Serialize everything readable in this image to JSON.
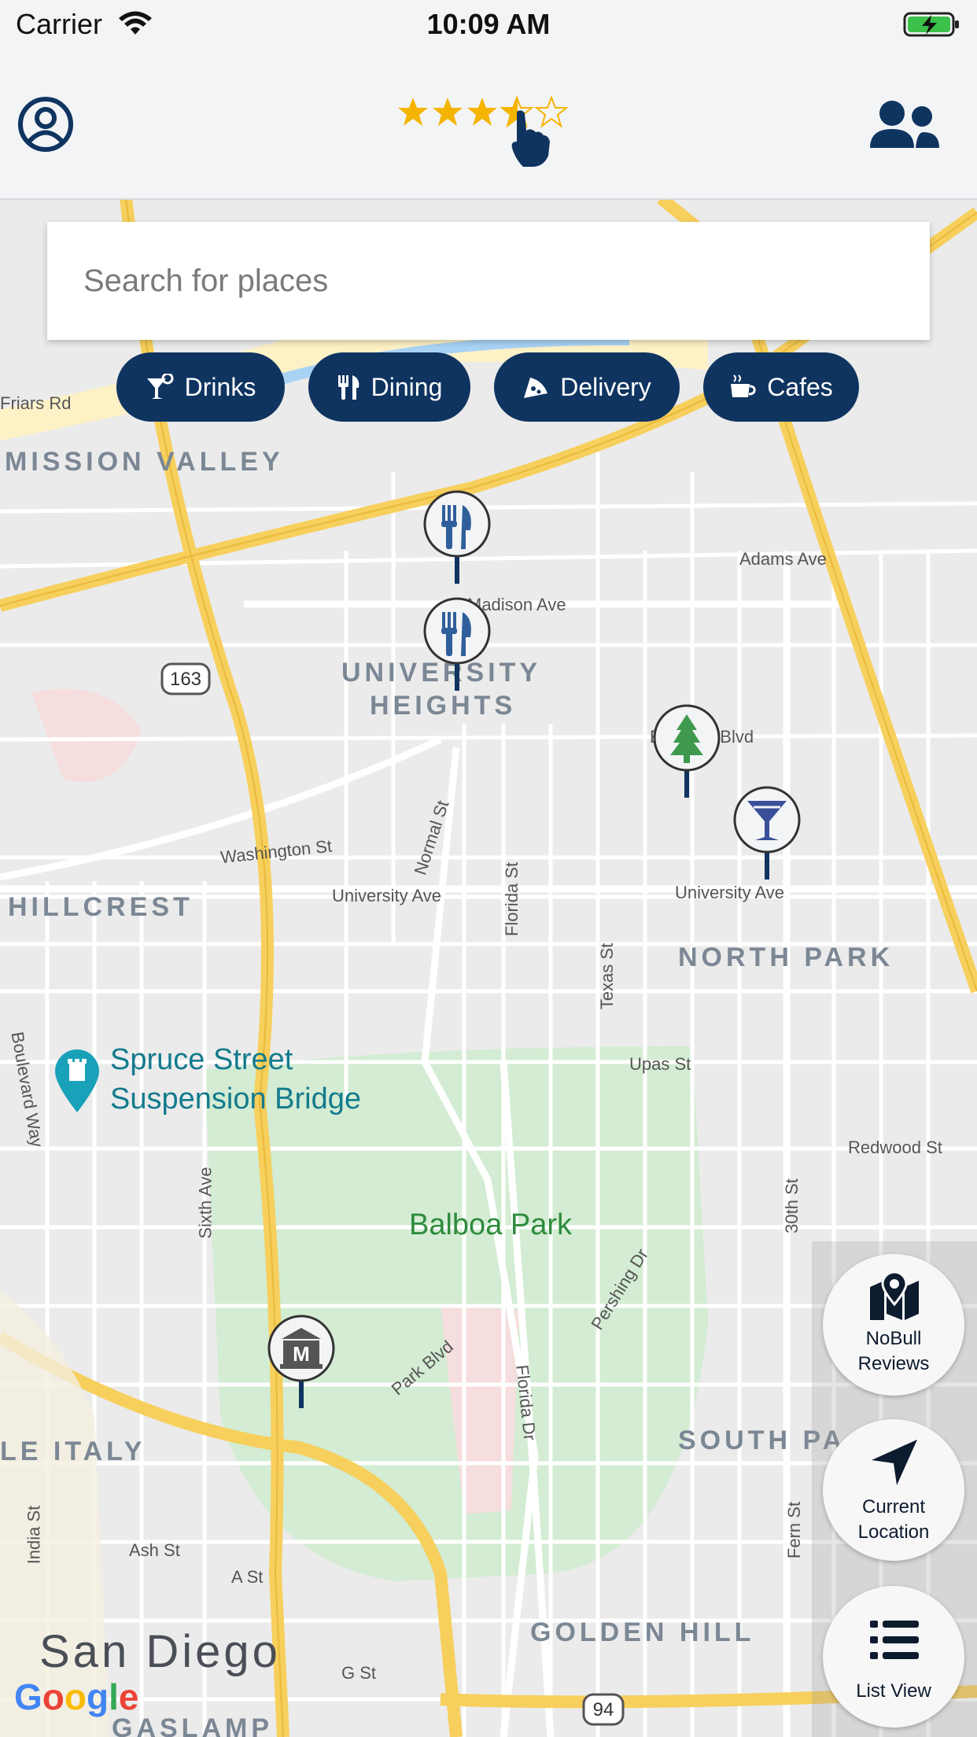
{
  "status_bar": {
    "carrier": "Carrier",
    "time": "10:09 AM"
  },
  "header": {
    "rating": {
      "value": 3.5,
      "max": 5
    },
    "profile_icon": "user-circle-icon",
    "friends_icon": "users-icon"
  },
  "search": {
    "placeholder": "Search for places"
  },
  "filters": [
    {
      "label": "Drinks",
      "icon": "cocktail-icon"
    },
    {
      "label": "Dining",
      "icon": "utensils-icon"
    },
    {
      "label": "Delivery",
      "icon": "pizza-icon"
    },
    {
      "label": "Cafes",
      "icon": "coffee-icon"
    }
  ],
  "map": {
    "districts": [
      "MISSION VALLEY",
      "UNIVERSITY",
      "HEIGHTS",
      "HILLCREST",
      "NORTH PARK",
      "SOUTH PA",
      "LE ITALY",
      "GOLDEN HILL",
      "GASLAMP"
    ],
    "city": "San Diego",
    "streets": [
      "Friars Rd",
      "Adams Ave",
      "Madison Ave",
      "Washington St",
      "Normal St",
      "University Ave",
      "University Ave",
      "Florida St",
      "Texas St",
      "Upas St",
      "Redwood St",
      "30th St",
      "Sixth Ave",
      "Park Blvd",
      "Pershing Dr",
      "Florida Dr",
      "Fern St",
      "Ash St",
      "A St",
      "G St",
      "India St",
      "Boulevard Way",
      "El Cajon Blvd"
    ],
    "shields": [
      "163",
      "94"
    ],
    "poi": [
      "Spruce Street",
      "Suspension Bridge"
    ],
    "park": "Balboa Park",
    "attribution": "Google",
    "pins": [
      "dining-pin",
      "dining-pin",
      "park-pin",
      "drinks-pin",
      "museum-pin"
    ]
  },
  "fabs": {
    "reviews": [
      "NoBull",
      "Reviews"
    ],
    "location": [
      "Current",
      "Location"
    ],
    "list": "List View"
  },
  "colors": {
    "brand": "#0f3460",
    "star": "#f5b400"
  }
}
